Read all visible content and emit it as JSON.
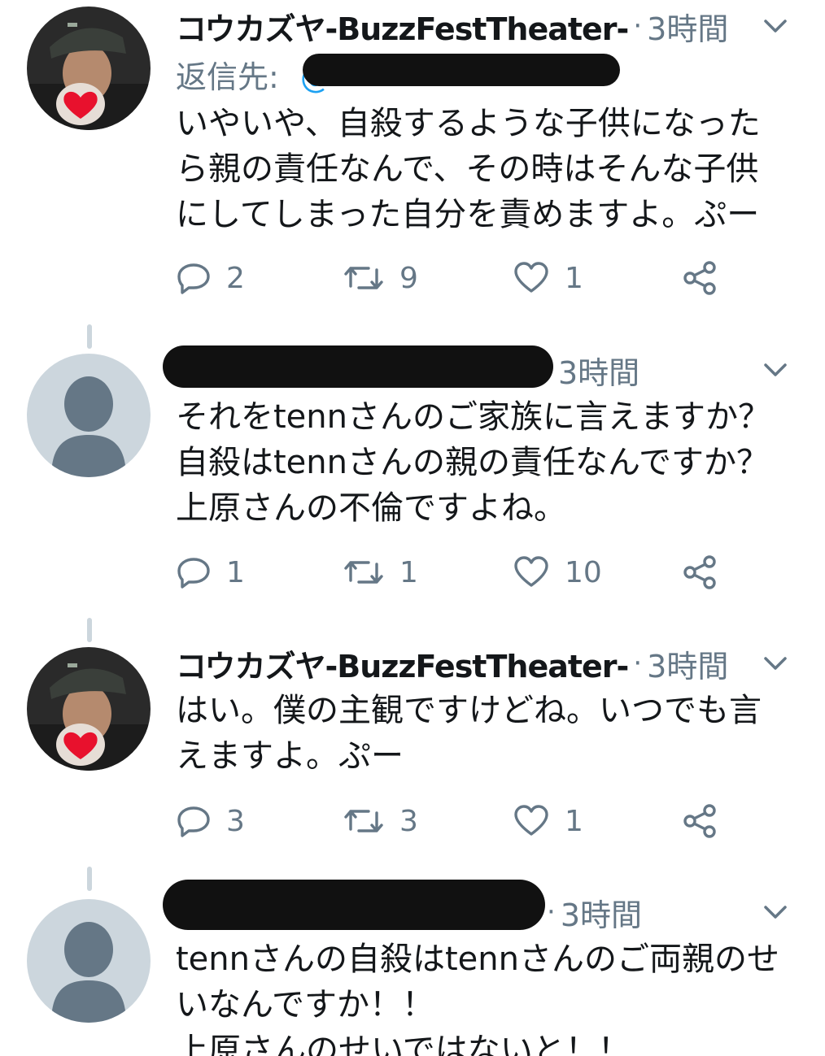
{
  "tweets": [
    {
      "author": "コウカズヤ-BuzzFestTheater-",
      "time": "3時間",
      "reply_label": "返信先:",
      "reply_handle_fragment": "@",
      "lines": [
        "いやいや、自殺するような子供になった",
        "ら親の責任なんで、その時はそんな子供",
        "にしてしまった自分を責めますよ。ぷー"
      ],
      "replies": "2",
      "retweets": "9",
      "likes": "1"
    },
    {
      "time": "3時間",
      "lines": [
        "それをtennさんのご家族に言えますか？",
        "自殺はtennさんの親の責任なんですか？",
        "上原さんの不倫ですよね。"
      ],
      "replies": "1",
      "retweets": "1",
      "likes": "10"
    },
    {
      "author": "コウカズヤ-BuzzFestTheater-",
      "time": "3時間",
      "lines": [
        "はい。僕の主観ですけどね。いつでも言",
        "えますよ。ぷー"
      ],
      "replies": "3",
      "retweets": "3",
      "likes": "1"
    },
    {
      "time": "3時間",
      "lines": [
        "tennさんの自殺はtennさんのご両親のせ",
        "いなんですか！！",
        "上原さんのせいではないと！！"
      ]
    }
  ],
  "icons": {
    "reply": "reply-icon",
    "retweet": "retweet-icon",
    "like": "heart-icon",
    "share": "share-icon",
    "more": "chevron-down-icon"
  },
  "colors": {
    "text": "#14171a",
    "secondary": "#657786",
    "icon": "#657786",
    "thread_line": "#ccd6dd",
    "default_avatar_bg": "#ccd6dd",
    "default_avatar_fg": "#657786",
    "redaction": "#111111"
  }
}
